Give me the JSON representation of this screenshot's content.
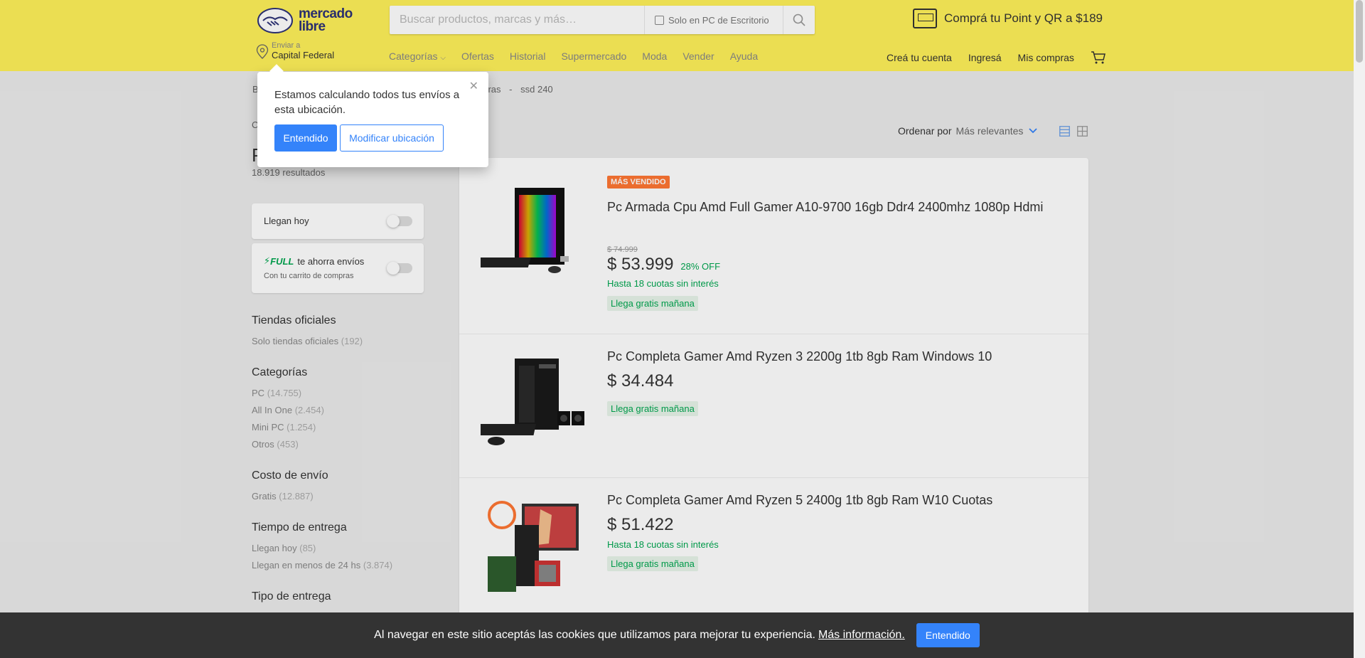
{
  "header": {
    "logo_text_1": "mercado",
    "logo_text_2": "libre",
    "search_placeholder": "Buscar productos, marcas y más…",
    "search_checkbox_label": "Solo en PC de Escritorio",
    "promo_text": "Comprá tu Point y QR a $189",
    "location_label": "Enviar a",
    "location_value": "Capital Federal",
    "nav": [
      "Categorías",
      "Ofertas",
      "Historial",
      "Supermercado",
      "Moda",
      "Vender",
      "Ayuda"
    ],
    "user_nav": [
      "Creá tu cuenta",
      "Ingresá",
      "Mis compras"
    ]
  },
  "breadcrumb": {
    "first": "B",
    "mid": "doras",
    "sep": "-",
    "last": "ssd 240"
  },
  "sort": {
    "label": "Ordenar por",
    "value": "Más relevantes"
  },
  "sidebar": {
    "heading_partial": "P",
    "results": "18.919 resultados",
    "side_letter": "C",
    "llegan_hoy": "Llegan hoy",
    "full_label": "FULL",
    "full_text": "te ahorra envíos",
    "full_sub": "Con tu carrito de compras",
    "sections": [
      {
        "title": "Tiendas oficiales",
        "items": [
          {
            "label": "Solo tiendas oficiales",
            "count": "(192)"
          }
        ]
      },
      {
        "title": "Categorías",
        "items": [
          {
            "label": "PC",
            "count": "(14.755)"
          },
          {
            "label": "All In One",
            "count": "(2.454)"
          },
          {
            "label": "Mini PC",
            "count": "(1.254)"
          },
          {
            "label": "Otros",
            "count": "(453)"
          }
        ]
      },
      {
        "title": "Costo de envío",
        "items": [
          {
            "label": "Gratis",
            "count": "(12.887)"
          }
        ]
      },
      {
        "title": "Tiempo de entrega",
        "items": [
          {
            "label": "Llegan hoy",
            "count": "(85)"
          },
          {
            "label": "Llegan en menos de 24 hs",
            "count": "(3.874)"
          }
        ]
      },
      {
        "title": "Tipo de entrega",
        "items": []
      }
    ]
  },
  "products": [
    {
      "badge": "MÁS VENDIDO",
      "title": "Pc Armada Cpu Amd Full Gamer A10-9700 16gb Ddr4 2400mhz 1080p Hdmi",
      "old_price": "$ 74.999",
      "price": "$ 53.999",
      "off": "28% OFF",
      "cuotas": "Hasta 18 cuotas sin interés",
      "shipping": "Llega gratis mañana"
    },
    {
      "title": "Pc Completa Gamer Amd Ryzen 3 2200g 1tb 8gb Ram Windows 10",
      "price": "$ 34.484",
      "shipping": "Llega gratis mañana"
    },
    {
      "title": "Pc Completa Gamer Amd Ryzen 5 2400g 1tb 8gb Ram W10 Cuotas",
      "price": "$ 51.422",
      "cuotas": "Hasta 18 cuotas sin interés",
      "shipping": "Llega gratis mañana"
    }
  ],
  "popup": {
    "text": "Estamos calculando todos tus envíos a esta ubicación.",
    "primary": "Entendido",
    "secondary": "Modificar ubicación"
  },
  "cookie": {
    "text": "Al navegar en este sitio aceptás las cookies que utilizamos para mejorar tu experiencia.",
    "link": "Más información.",
    "button": "Entendido"
  },
  "colors": {
    "brand_yellow": "#fff159",
    "accent_blue": "#3483fa",
    "green": "#00a650",
    "badge_orange": "#ff7733"
  }
}
